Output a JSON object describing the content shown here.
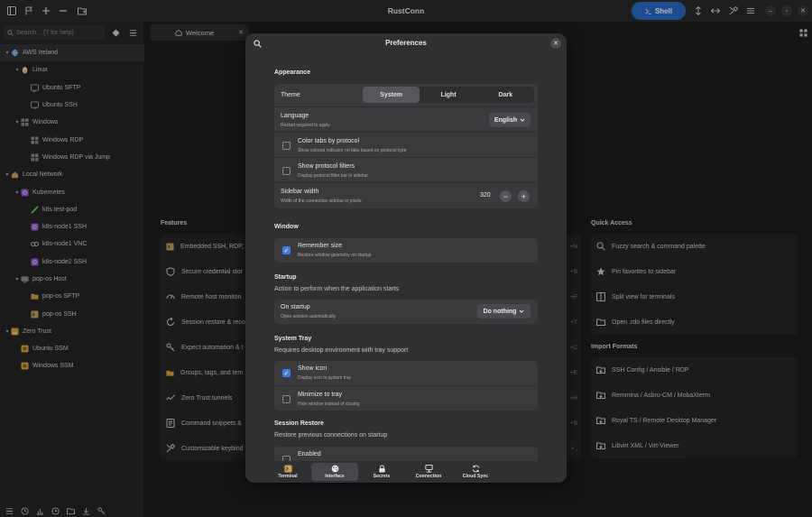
{
  "app": {
    "title": "RustConn",
    "shell_label": "Shell"
  },
  "sidebar": {
    "search_placeholder": "Search... (? for help)",
    "items": [
      {
        "label": "AWS Ireland",
        "level": 0,
        "icon": "globe-icon",
        "expanded": true,
        "selected": true
      },
      {
        "label": "Linux",
        "level": 1,
        "icon": "linux-icon",
        "expanded": true
      },
      {
        "label": "Ubuntu SFTP",
        "level": 2,
        "icon": "ubuntu-icon"
      },
      {
        "label": "Ubuntu SSH",
        "level": 2,
        "icon": "ubuntu-icon"
      },
      {
        "label": "Windows",
        "level": 1,
        "icon": "windows-icon",
        "expanded": true
      },
      {
        "label": "Windows RDP",
        "level": 2,
        "icon": "windows-icon"
      },
      {
        "label": "Windows RDP via Jump",
        "level": 2,
        "icon": "windows-icon"
      },
      {
        "label": "Local Network",
        "level": 0,
        "icon": "home-icon",
        "expanded": true
      },
      {
        "label": "Kubernetes",
        "level": 1,
        "icon": "kubernetes-icon",
        "expanded": true
      },
      {
        "label": "k8s test-pod",
        "level": 2,
        "icon": "pod-icon"
      },
      {
        "label": "k8s-node1 SSH",
        "level": 2,
        "icon": "kubernetes-icon"
      },
      {
        "label": "k8s-node1 VNC",
        "level": 2,
        "icon": "vnc-icon"
      },
      {
        "label": "k8s-node2 SSH",
        "level": 2,
        "icon": "kubernetes-icon"
      },
      {
        "label": "pop-os Host",
        "level": 1,
        "icon": "host-icon",
        "expanded": true
      },
      {
        "label": "pop-os SFTP",
        "level": 2,
        "icon": "folder-icon"
      },
      {
        "label": "pop-os SSH",
        "level": 2,
        "icon": "terminal-icon"
      },
      {
        "label": "Zero Trust",
        "level": 0,
        "icon": "cloud-icon",
        "expanded": true
      },
      {
        "label": "Ubuntu SSM",
        "level": 1,
        "icon": "ssm-icon"
      },
      {
        "label": "Windows SSM",
        "level": 1,
        "icon": "ssm-icon"
      }
    ]
  },
  "tabs": {
    "welcome": "Welcome"
  },
  "welcome": {
    "features_title": "Features",
    "features": [
      {
        "label": "Embedded SSH, RDP, V",
        "shortcut": "+N",
        "icon": "terminal-icon"
      },
      {
        "label": "Secure credential stor",
        "shortcut": "+S",
        "icon": "shield-icon"
      },
      {
        "label": "Remote host monitori",
        "shortcut": "+F",
        "icon": "gauge-icon"
      },
      {
        "label": "Session restore & reco",
        "shortcut": "+T",
        "icon": "restore-icon"
      },
      {
        "label": "Expect automation & t",
        "shortcut": "+C",
        "icon": "key-icon"
      },
      {
        "label": "Groups, tags, and tem",
        "shortcut": "+E",
        "icon": "folder-icon"
      },
      {
        "label": "Zero Trust tunnels",
        "shortcut": "+H",
        "icon": "tunnel-icon"
      },
      {
        "label": "Command snippets &",
        "shortcut": "+S",
        "icon": "snippet-icon"
      },
      {
        "label": "Customizable keybind",
        "shortcut": "+ ,",
        "icon": "tools-icon"
      }
    ],
    "quick_access_title": "Quick Access",
    "quick_access": [
      {
        "label": "Fuzzy search & command palette",
        "icon": "search-icon"
      },
      {
        "label": "Pin favorites to sidebar",
        "icon": "star-icon"
      },
      {
        "label": "Split view for terminals",
        "icon": "split-icon"
      },
      {
        "label": "Open .rdo files directly",
        "icon": "file-icon"
      }
    ],
    "import_title": "Import Formats",
    "import_formats": [
      {
        "label": "SSH Config / Ansible / RDP",
        "icon": "import-icon"
      },
      {
        "label": "Remmina / Asbru-CM / MobaXterm",
        "icon": "import-icon"
      },
      {
        "label": "Royal TS / Remote Desktop Manager",
        "icon": "import-icon"
      },
      {
        "label": "Libvirt XML / Virt-Viewer",
        "icon": "import-icon"
      }
    ]
  },
  "prefs": {
    "title": "Preferences",
    "appearance": {
      "title": "Appearance",
      "theme_label": "Theme",
      "theme_options": [
        "System",
        "Light",
        "Dark"
      ],
      "theme_selected": "System",
      "language_label": "Language",
      "language_sub": "Restart required to apply",
      "language_value": "English",
      "color_tabs_label": "Color tabs by protocol",
      "color_tabs_sub": "Show colored indicator on tabs based on protocol type",
      "color_tabs_checked": false,
      "protocol_filters_label": "Show protocol filters",
      "protocol_filters_sub": "Display protocol filter bar in sidebar",
      "protocol_filters_checked": false,
      "sidebar_width_label": "Sidebar width",
      "sidebar_width_sub": "Width of the connection sidebar in pixels",
      "sidebar_width_value": "320"
    },
    "window": {
      "title": "Window",
      "remember_size_label": "Remember size",
      "remember_size_sub": "Restore window geometry on startup",
      "remember_size_checked": true
    },
    "startup": {
      "title": "Startup",
      "desc": "Action to perform when the application starts",
      "on_startup_label": "On startup",
      "on_startup_sub": "Open session automatically",
      "on_startup_value": "Do nothing"
    },
    "tray": {
      "title": "System Tray",
      "desc": "Requires desktop environment with tray support",
      "show_icon_label": "Show icon",
      "show_icon_sub": "Display icon in system tray",
      "show_icon_checked": true,
      "minimize_label": "Minimize to tray",
      "minimize_sub": "Hide window instead of closing",
      "minimize_checked": false
    },
    "session_restore": {
      "title": "Session Restore",
      "desc": "Restore previous connections on startup",
      "enabled_label": "Enabled",
      "enabled_checked": false
    },
    "nav": [
      {
        "label": "Terminal",
        "icon": "terminal-icon"
      },
      {
        "label": "Interface",
        "icon": "palette-icon",
        "active": true
      },
      {
        "label": "Secrets",
        "icon": "lock-icon"
      },
      {
        "label": "Connection",
        "icon": "network-icon"
      },
      {
        "label": "Cloud Sync",
        "icon": "sync-icon"
      }
    ]
  },
  "colors": {
    "accent": "#2a6ac9",
    "checkbox": "#3f7fe0"
  }
}
